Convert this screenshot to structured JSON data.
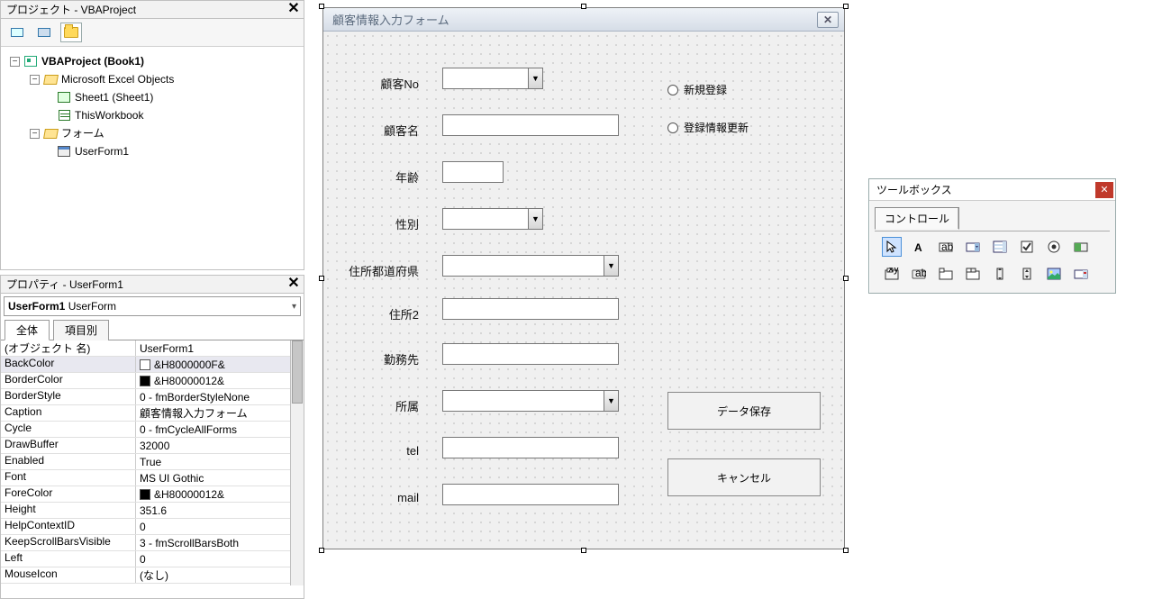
{
  "project_panel": {
    "title": "プロジェクト - VBAProject",
    "tree": {
      "root": "VBAProject (Book1)",
      "folder1": "Microsoft Excel Objects",
      "sheet1": "Sheet1 (Sheet1)",
      "workbook": "ThisWorkbook",
      "folder2": "フォーム",
      "userform": "UserForm1"
    }
  },
  "properties_panel": {
    "title": "プロパティ - UserForm1",
    "combo_name": "UserForm1",
    "combo_type": "UserForm",
    "tabs": {
      "all": "全体",
      "bycat": "項目別"
    },
    "rows": [
      {
        "k": "(オブジェクト 名)",
        "v": "UserForm1"
      },
      {
        "k": "BackColor",
        "v": "&H8000000F&",
        "swatch": "white",
        "sel": true
      },
      {
        "k": "BorderColor",
        "v": "&H80000012&",
        "swatch": "black"
      },
      {
        "k": "BorderStyle",
        "v": "0 - fmBorderStyleNone"
      },
      {
        "k": "Caption",
        "v": "顧客情報入力フォーム"
      },
      {
        "k": "Cycle",
        "v": "0 - fmCycleAllForms"
      },
      {
        "k": "DrawBuffer",
        "v": "32000"
      },
      {
        "k": "Enabled",
        "v": "True"
      },
      {
        "k": "Font",
        "v": "MS UI Gothic"
      },
      {
        "k": "ForeColor",
        "v": "&H80000012&",
        "swatch": "black"
      },
      {
        "k": "Height",
        "v": "351.6"
      },
      {
        "k": "HelpContextID",
        "v": "0"
      },
      {
        "k": "KeepScrollBarsVisible",
        "v": "3 - fmScrollBarsBoth"
      },
      {
        "k": "Left",
        "v": "0"
      },
      {
        "k": "MouseIcon",
        "v": "(なし)"
      }
    ]
  },
  "userform": {
    "caption": "顧客情報入力フォーム",
    "labels": {
      "no": "顧客No",
      "name": "顧客名",
      "age": "年齢",
      "gender": "性別",
      "pref": "住所都道府県",
      "addr2": "住所2",
      "company": "勤務先",
      "dept": "所属",
      "tel": "tel",
      "mail": "mail"
    },
    "radios": {
      "new": "新規登録",
      "update": "登録情報更新"
    },
    "buttons": {
      "save": "データ保存",
      "cancel": "キャンセル"
    }
  },
  "toolbox": {
    "title": "ツールボックス",
    "tab": "コントロール"
  }
}
